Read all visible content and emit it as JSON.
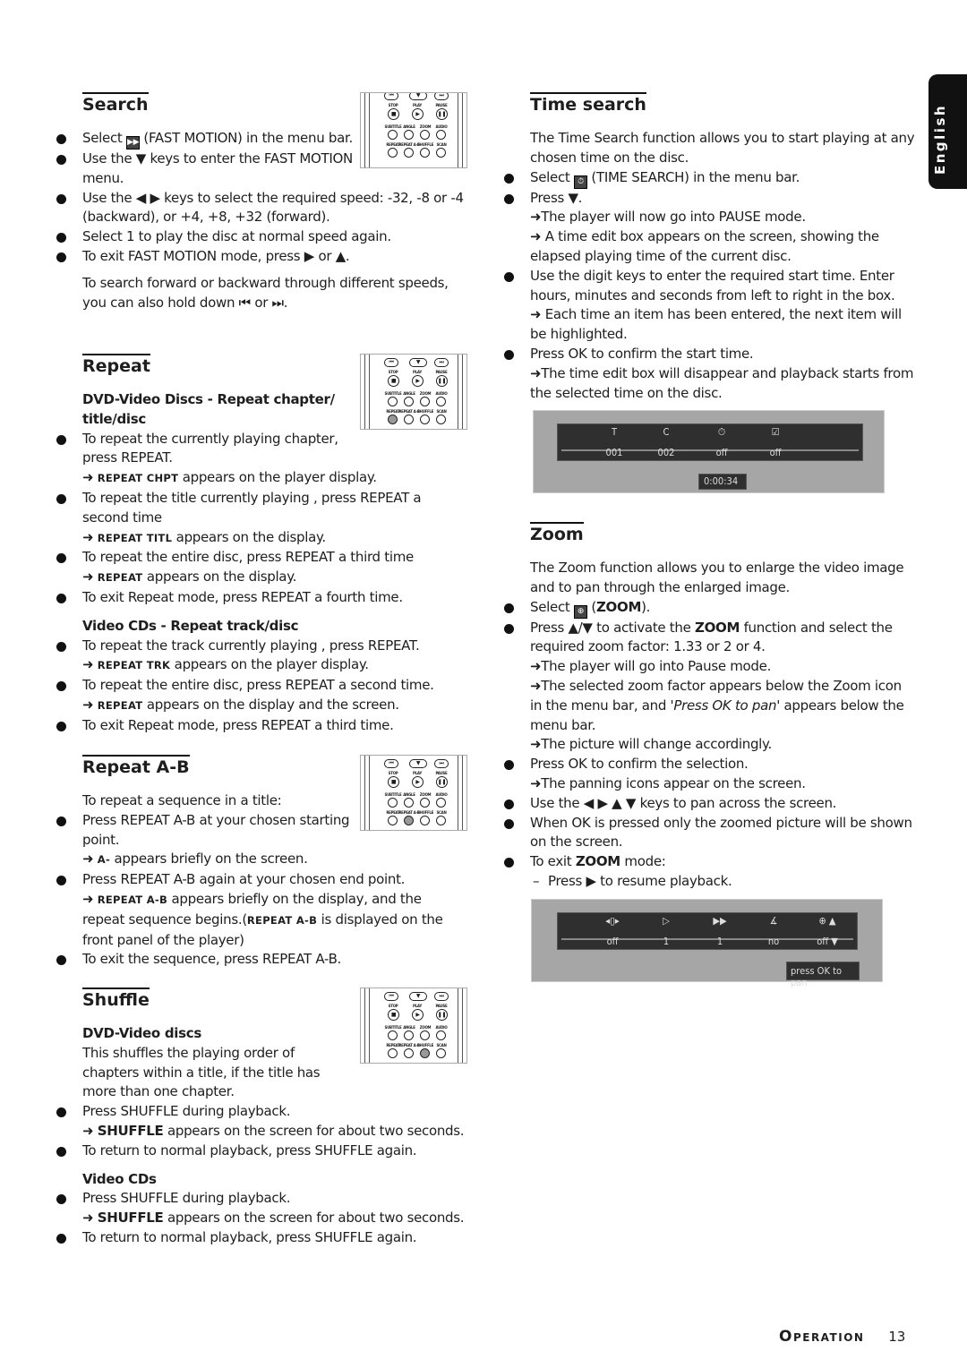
{
  "side_tab": "English",
  "footer": {
    "section": "Operation",
    "page": "13"
  },
  "remote_labels": {
    "stop": "STOP",
    "play": "PLAY",
    "pause": "PAUSE",
    "row1": [
      "SUBTITLE",
      "ANGLE",
      "ZOOM",
      "AUDIO"
    ],
    "row2": [
      "REPEAT",
      "REPEAT A-B",
      "SHUFFLE",
      "SCAN"
    ]
  },
  "left": [
    {
      "title": "Search",
      "remote_highlight": -1,
      "items": [
        {
          "k": "b",
          "s": [
            {
              "t": "Select "
            },
            {
              "ic": "fast-motion-icon",
              "g": "▶▶"
            },
            {
              "t": " (FAST MOTION) in the menu bar."
            }
          ]
        },
        {
          "k": "b",
          "s": [
            {
              "t": "Use the ▼ keys to enter the FAST MOTION menu."
            }
          ]
        },
        {
          "k": "b",
          "s": [
            {
              "t": "Use the ◀ ▶ keys to select the required speed: -32, -8 or -4 (backward), or +4, +8, +32 (forward)."
            }
          ]
        },
        {
          "k": "b",
          "s": [
            {
              "t": "Select 1 to play the disc at normal speed again."
            }
          ]
        },
        {
          "k": "b",
          "s": [
            {
              "t": "To exit FAST MOTION mode, press ▶ or ▲."
            }
          ]
        },
        {
          "k": "para",
          "s": [
            {
              "t": "To search forward or backward through different speeds, you can also hold down ⏮ or ⏭."
            }
          ]
        }
      ]
    },
    {
      "title": "Repeat",
      "remote_highlight": 0,
      "items": [
        {
          "k": "sub",
          "s": [
            {
              "t": "DVD-Video Discs - Repeat chapter/ title/disc"
            }
          ]
        },
        {
          "k": "b",
          "s": [
            {
              "t": "To repeat the currently playing chapter, press REPEAT."
            }
          ]
        },
        {
          "k": "n",
          "s": [
            {
              "t": "➜ "
            },
            {
              "sc": "REPEAT CHPT"
            },
            {
              "t": " appears on the player display."
            }
          ]
        },
        {
          "k": "b",
          "s": [
            {
              "t": "To repeat the title currently playing , press REPEAT a second time"
            }
          ]
        },
        {
          "k": "n",
          "s": [
            {
              "t": "➜ "
            },
            {
              "sc": "REPEAT TITL"
            },
            {
              "t": " appears on the display."
            }
          ]
        },
        {
          "k": "b",
          "s": [
            {
              "t": "To repeat the entire disc, press REPEAT a third time"
            }
          ]
        },
        {
          "k": "n",
          "s": [
            {
              "t": "➜ "
            },
            {
              "sc": "REPEAT"
            },
            {
              "t": " appears on the display."
            }
          ]
        },
        {
          "k": "b",
          "s": [
            {
              "t": "To exit Repeat mode, press REPEAT a fourth time."
            }
          ]
        },
        {
          "k": "sub",
          "s": [
            {
              "t": "Video CDs - Repeat track/disc"
            }
          ]
        },
        {
          "k": "b",
          "s": [
            {
              "t": "To repeat the track currently playing , press REPEAT."
            }
          ]
        },
        {
          "k": "n",
          "s": [
            {
              "t": "➜ "
            },
            {
              "sc": "REPEAT TRK"
            },
            {
              "t": " appears on the player display."
            }
          ]
        },
        {
          "k": "b",
          "s": [
            {
              "t": "To repeat the entire disc, press REPEAT a second time."
            }
          ]
        },
        {
          "k": "n",
          "s": [
            {
              "t": "➜ "
            },
            {
              "sc": "REPEAT"
            },
            {
              "t": " appears on the display and the screen."
            }
          ]
        },
        {
          "k": "b",
          "s": [
            {
              "t": "To exit Repeat mode, press REPEAT a third time."
            }
          ]
        }
      ]
    },
    {
      "title": "Repeat A-B",
      "remote_highlight": 1,
      "items": [
        {
          "k": "plain",
          "s": [
            {
              "t": "To repeat a sequence in a title:"
            }
          ]
        },
        {
          "k": "b",
          "s": [
            {
              "t": "Press REPEAT A-B at your chosen starting point."
            }
          ]
        },
        {
          "k": "n",
          "s": [
            {
              "t": "➜ "
            },
            {
              "sc": "A-"
            },
            {
              "t": " appears briefly on the screen."
            }
          ]
        },
        {
          "k": "b",
          "s": [
            {
              "t": "Press REPEAT A-B again at your chosen end point."
            }
          ]
        },
        {
          "k": "n",
          "s": [
            {
              "t": "➜ "
            },
            {
              "sc": "REPEAT A-B"
            },
            {
              "t": " appears briefly on the display, and the repeat sequence begins.("
            },
            {
              "sc": "REPEAT A-B"
            },
            {
              "t": " is displayed on the front panel of the player)"
            }
          ]
        },
        {
          "k": "b",
          "s": [
            {
              "t": "To exit the sequence, press REPEAT A-B."
            }
          ]
        }
      ]
    },
    {
      "title": "Shuffle",
      "remote_highlight": 2,
      "items": [
        {
          "k": "sub",
          "s": [
            {
              "t": "DVD-Video discs"
            }
          ]
        },
        {
          "k": "plain",
          "s": [
            {
              "t": "This shuffles the playing order of chapters within a title, if the title has more than one chapter."
            }
          ]
        },
        {
          "k": "b",
          "s": [
            {
              "t": "Press SHUFFLE during playback."
            }
          ]
        },
        {
          "k": "n",
          "s": [
            {
              "t": "➜ "
            },
            {
              "bd": "SHUFFLE"
            },
            {
              "t": " appears on the screen for about two seconds."
            }
          ]
        },
        {
          "k": "b",
          "s": [
            {
              "t": "To return to normal playback, press SHUFFLE again."
            }
          ]
        },
        {
          "k": "sub",
          "s": [
            {
              "t": "Video CDs"
            }
          ]
        },
        {
          "k": "b",
          "s": [
            {
              "t": "Press SHUFFLE during playback."
            }
          ]
        },
        {
          "k": "n",
          "s": [
            {
              "t": "➜ "
            },
            {
              "bd": "SHUFFLE"
            },
            {
              "t": " appears on the screen for about two seconds."
            }
          ]
        },
        {
          "k": "b",
          "s": [
            {
              "t": "To return to normal playback, press SHUFFLE again."
            }
          ]
        }
      ]
    }
  ],
  "right": [
    {
      "title": "Time search",
      "items": [
        {
          "k": "plain",
          "s": [
            {
              "t": "The Time Search function allows you to start playing at any chosen time on the disc."
            }
          ]
        },
        {
          "k": "b",
          "s": [
            {
              "t": "Select "
            },
            {
              "ic": "time-search-icon",
              "g": "⏱"
            },
            {
              "t": " (TIME SEARCH) in the menu bar."
            }
          ]
        },
        {
          "k": "b",
          "s": [
            {
              "t": "Press ▼."
            }
          ]
        },
        {
          "k": "n",
          "s": [
            {
              "t": "➜The player will now go into PAUSE mode."
            }
          ]
        },
        {
          "k": "n",
          "s": [
            {
              "t": "➜ A time edit box appears on the screen, showing the elapsed playing time of the current disc."
            }
          ]
        },
        {
          "k": "b",
          "s": [
            {
              "t": "Use the digit keys to enter the required start time. Enter hours, minutes and seconds from left to right in the box."
            }
          ]
        },
        {
          "k": "n",
          "s": [
            {
              "t": "➜ Each time an item has been entered, the next item will be highlighted."
            }
          ]
        },
        {
          "k": "b",
          "s": [
            {
              "t": "Press OK to confirm the start time."
            }
          ]
        },
        {
          "k": "n",
          "s": [
            {
              "t": "➜The time edit box will disappear and playback starts from the selected time on the disc."
            }
          ]
        }
      ]
    },
    {
      "title": "Zoom",
      "items": [
        {
          "k": "plain",
          "s": [
            {
              "t": "The Zoom function allows you to enlarge the video image and to pan through the enlarged image."
            }
          ]
        },
        {
          "k": "b",
          "s": [
            {
              "t": "Select "
            },
            {
              "ic": "zoom-icon",
              "g": "⊕"
            },
            {
              "t": " ("
            },
            {
              "bd": "ZOOM"
            },
            {
              "t": ")."
            }
          ]
        },
        {
          "k": "b",
          "s": [
            {
              "t": "Press ▲/▼ to activate the "
            },
            {
              "bd": "ZOOM"
            },
            {
              "t": " function and select the required zoom factor: 1.33 or 2 or 4."
            }
          ]
        },
        {
          "k": "n",
          "s": [
            {
              "t": "➜The player will go into Pause mode."
            }
          ]
        },
        {
          "k": "n",
          "s": [
            {
              "t": "➜The selected zoom factor appears below the Zoom icon in the menu bar, and '"
            },
            {
              "i": "Press OK to pan"
            },
            {
              "t": "' appears below the menu bar."
            }
          ]
        },
        {
          "k": "n",
          "s": [
            {
              "t": "➜The picture will change accordingly."
            }
          ]
        },
        {
          "k": "b",
          "s": [
            {
              "t": "Press OK to confirm the selection."
            }
          ]
        },
        {
          "k": "n",
          "s": [
            {
              "t": "➜The panning icons appear on the screen."
            }
          ]
        },
        {
          "k": "b",
          "s": [
            {
              "t": "Use the ◀ ▶ ▲ ▼ keys to pan across the screen."
            }
          ]
        },
        {
          "k": "b",
          "s": [
            {
              "t": "When OK is pressed only the zoomed picture will be shown on the screen."
            }
          ]
        },
        {
          "k": "b",
          "s": [
            {
              "t": "To exit "
            },
            {
              "bd": "ZOOM"
            },
            {
              "t": " mode:"
            }
          ]
        },
        {
          "k": "dash",
          "s": [
            {
              "t": "Press ▶ to resume playback."
            }
          ]
        }
      ]
    }
  ],
  "time_screen": {
    "icons": [
      "T",
      "C",
      "⏱",
      "☑"
    ],
    "values": [
      "001",
      "002",
      "off",
      "off"
    ],
    "time": "0:00:34"
  },
  "zoom_screen": {
    "icons": [
      "◂▯▸",
      "▷",
      "▶▶",
      "∡",
      "⊕ ▲"
    ],
    "values": [
      "off",
      "1",
      "1",
      "no",
      "off ▼"
    ],
    "hint": "press OK to pan"
  }
}
